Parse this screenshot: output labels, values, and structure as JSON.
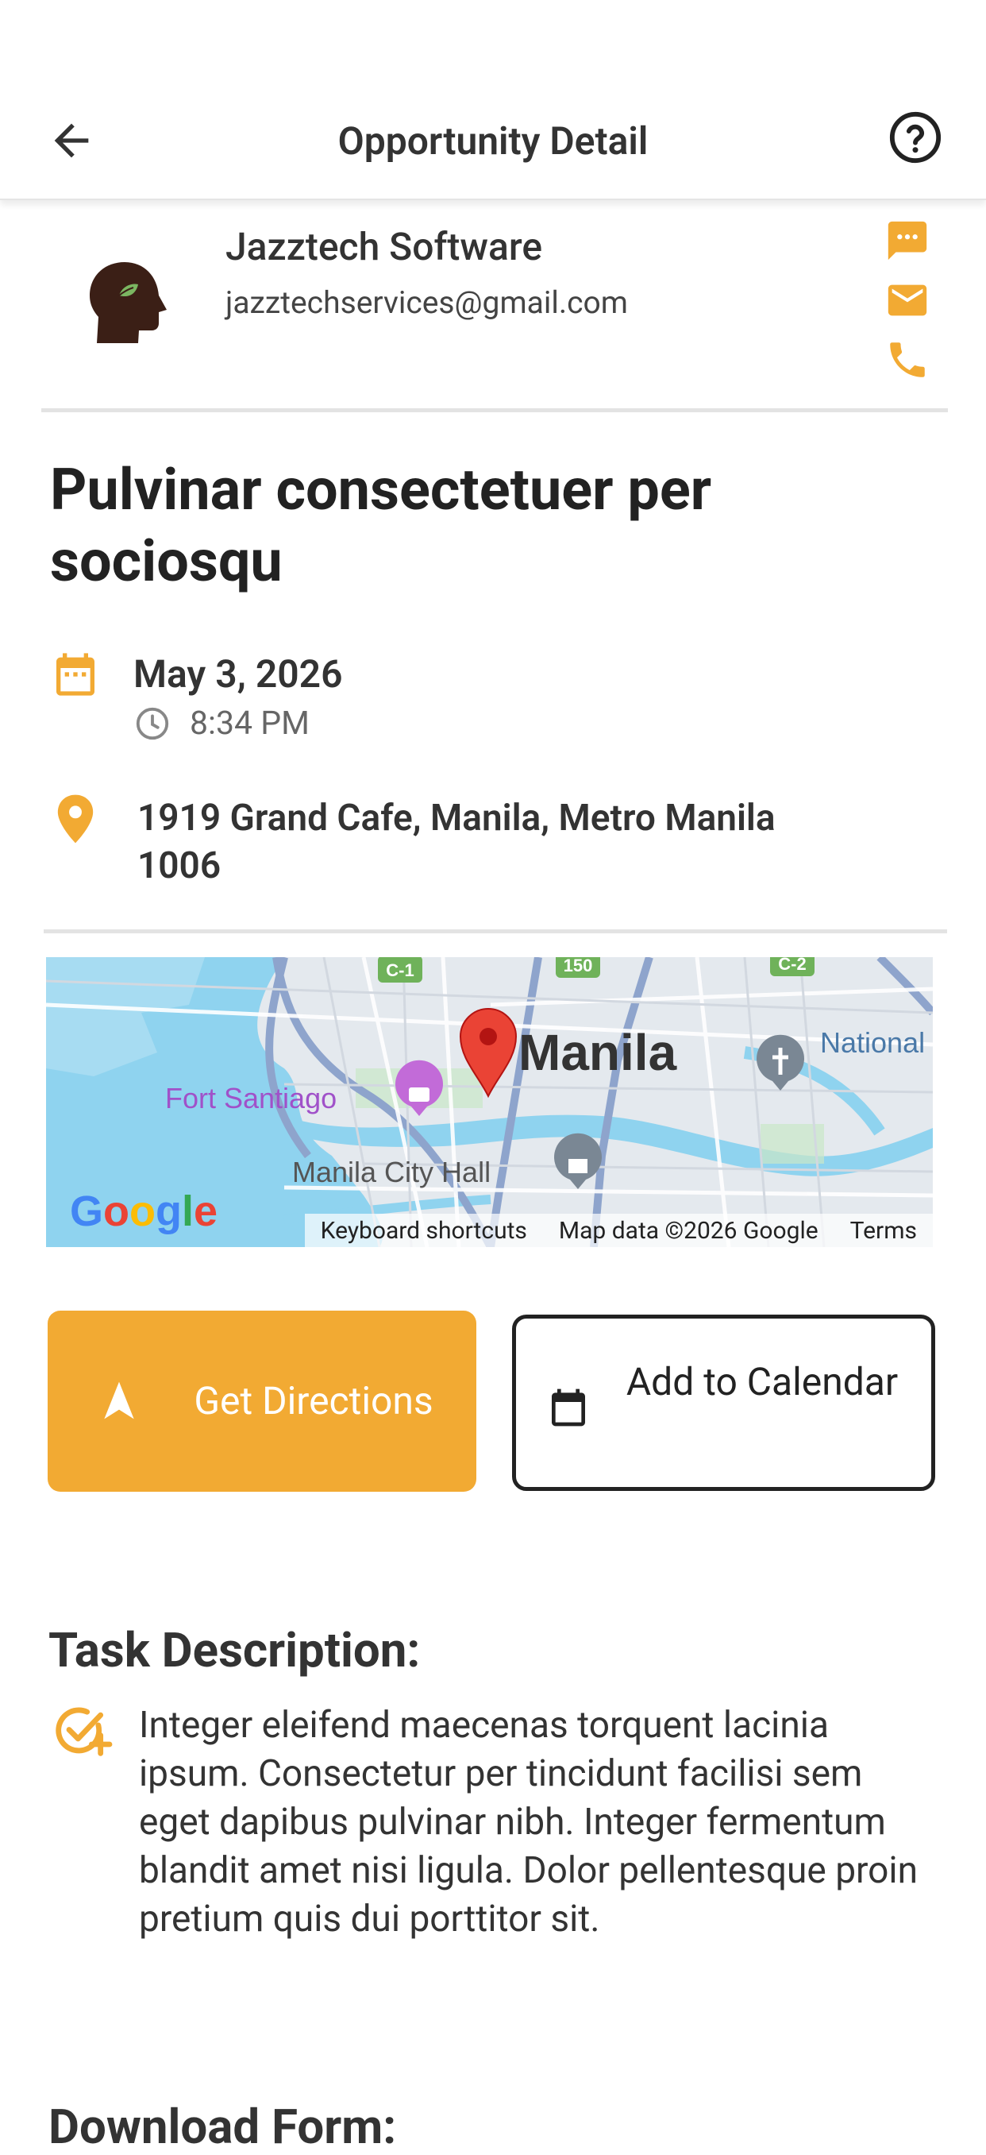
{
  "header": {
    "title": "Opportunity Detail"
  },
  "company": {
    "name": "Jazztech Software",
    "email": "jazztechservices@gmail.com"
  },
  "opportunity": {
    "title": "Pulvinar consectetuer per sociosqu",
    "date": "May 3, 2026",
    "time": "8:34 PM",
    "address": "1919 Grand Cafe, Manila, Metro Manila 1006"
  },
  "map": {
    "city_label": "Manila",
    "poi_fort": "Fort Santiago",
    "poi_cityhall": "Manila City Hall",
    "poi_national": "National Saint Ju",
    "road_c1": "C-1",
    "road_150": "150",
    "road_c2": "C-2",
    "google": "Google",
    "footer_shortcuts": "Keyboard shortcuts",
    "footer_data": "Map data ©2026 Google",
    "footer_terms": "Terms"
  },
  "actions": {
    "directions": "Get Directions",
    "calendar": "Add to Calendar"
  },
  "task": {
    "heading": "Task Description:",
    "description": "Integer eleifend maecenas torquent lacinia ipsum. Consectetur per tincidunt facilisi sem eget dapibus pulvinar nibh. Integer fermentum blandit amet nisi ligula. Dolor pellentesque proin pretium quis dui porttitor sit."
  },
  "download": {
    "heading": "Download Form:"
  },
  "colors": {
    "accent": "#f2aa33",
    "text": "#222222",
    "divider": "#e3e3e3"
  }
}
